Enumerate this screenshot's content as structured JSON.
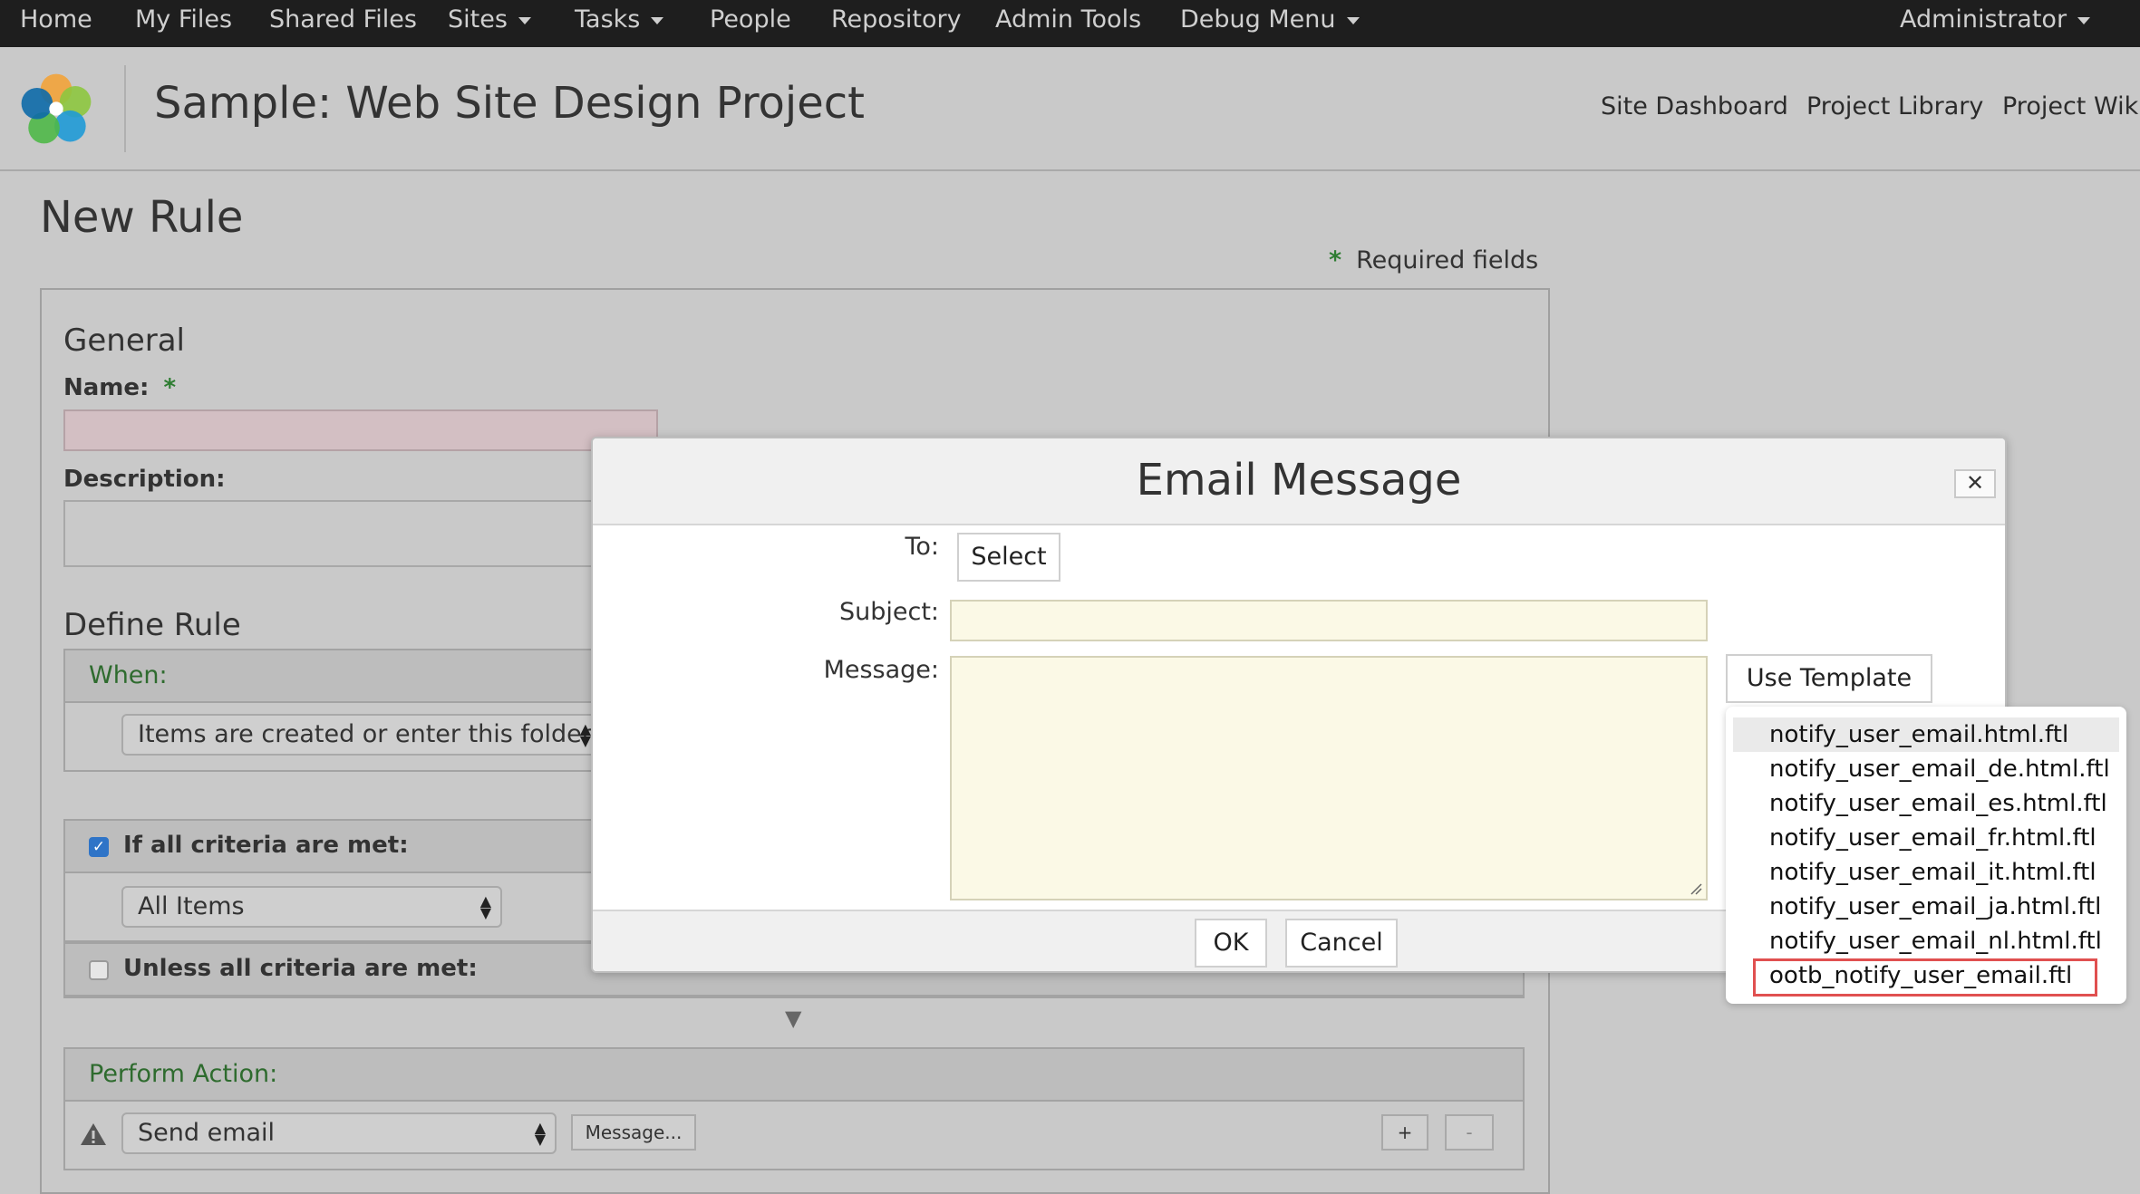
{
  "topnav": {
    "items": [
      "Home",
      "My Files",
      "Shared Files",
      "Sites",
      "Tasks",
      "People",
      "Repository",
      "Admin Tools",
      "Debug Menu"
    ],
    "user": "Administrator"
  },
  "site": {
    "title": "Sample: Web Site Design Project",
    "nav": [
      "Site Dashboard",
      "Project Library",
      "Project Wiki"
    ]
  },
  "page": {
    "title": "New Rule",
    "required_note": "Required fields",
    "required_star": "*"
  },
  "general": {
    "heading": "General",
    "name_label": "Name:",
    "description_label": "Description:"
  },
  "define_rule": {
    "heading": "Define Rule",
    "when_label": "When:",
    "when_value": "Items are created or enter this folder",
    "if_label": "If all criteria are met:",
    "if_checked": true,
    "criteria_value": "All Items",
    "unless_label": "Unless all criteria are met:",
    "unless_checked": false,
    "arrow": "▼",
    "perform_label": "Perform Action:",
    "action_value": "Send email",
    "message_button": "Message...",
    "add_button": "+",
    "remove_button": "-"
  },
  "modal": {
    "title": "Email Message",
    "close": "✕",
    "to_label": "To:",
    "select_button": "Select",
    "subject_label": "Subject:",
    "message_label": "Message:",
    "use_template_button": "Use Template",
    "ok_button": "OK",
    "cancel_button": "Cancel"
  },
  "template_menu": {
    "items": [
      "notify_user_email.html.ftl",
      "notify_user_email_de.html.ftl",
      "notify_user_email_es.html.ftl",
      "notify_user_email_fr.html.ftl",
      "notify_user_email_it.html.ftl",
      "notify_user_email_ja.html.ftl",
      "notify_user_email_nl.html.ftl",
      "ootb_notify_user_email.ftl"
    ],
    "hovered_index": 0,
    "highlighted_index": 7
  },
  "colors": {
    "topbar": "#1e1e1e",
    "required_star": "#2e7d32",
    "section_label_green": "#2e6b2e",
    "checkbox_checked": "#2f74c7",
    "input_yellow": "#fbf9e6",
    "highlight_red": "#e05050"
  }
}
